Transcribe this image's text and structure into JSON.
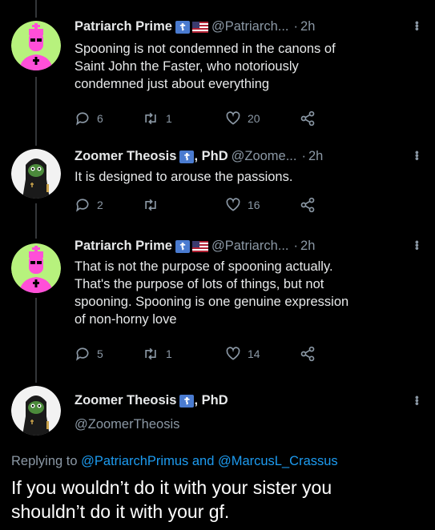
{
  "tweets": [
    {
      "name": "Patriarch Prime",
      "handle": "@Patriarch...",
      "time": "2h",
      "text": "Spooning is not condemned in the canons of Saint John the Faster, who notoriously condemned just about everything",
      "replies": "6",
      "retweets": "1",
      "likes": "20"
    },
    {
      "name": "Zoomer Theosis",
      "suffix": ", PhD",
      "handle": "@Zoome...",
      "time": "2h",
      "text": "It is designed to arouse the passions.",
      "replies": "2",
      "retweets": "",
      "likes": "16"
    },
    {
      "name": "Patriarch Prime",
      "handle": "@Patriarch...",
      "time": "2h",
      "text": "That is not the purpose of spooning actually. That's the purpose of lots of things, but not spooning. Spooning is one genuine expression of non-horny love",
      "replies": "5",
      "retweets": "1",
      "likes": "14"
    }
  ],
  "main": {
    "name": "Zoomer Theosis",
    "suffix": ", PhD",
    "handle": "@ZoomerTheosis",
    "replying_prefix": "Replying to ",
    "reply_user1": "@PatriarchPrimus",
    "reply_and": " and ",
    "reply_user2": "@MarcusL_Crassus",
    "text": "If you wouldn’t do it with your sister you shouldn’t do it with your gf."
  },
  "colors": {
    "background": "#000000",
    "text": "#e7e9ea",
    "muted": "#8b98a5",
    "link": "#1d9bf0",
    "avatar_prime_bg": "#b7f27d",
    "avatar_prime_figure": "#ff4fd8"
  }
}
